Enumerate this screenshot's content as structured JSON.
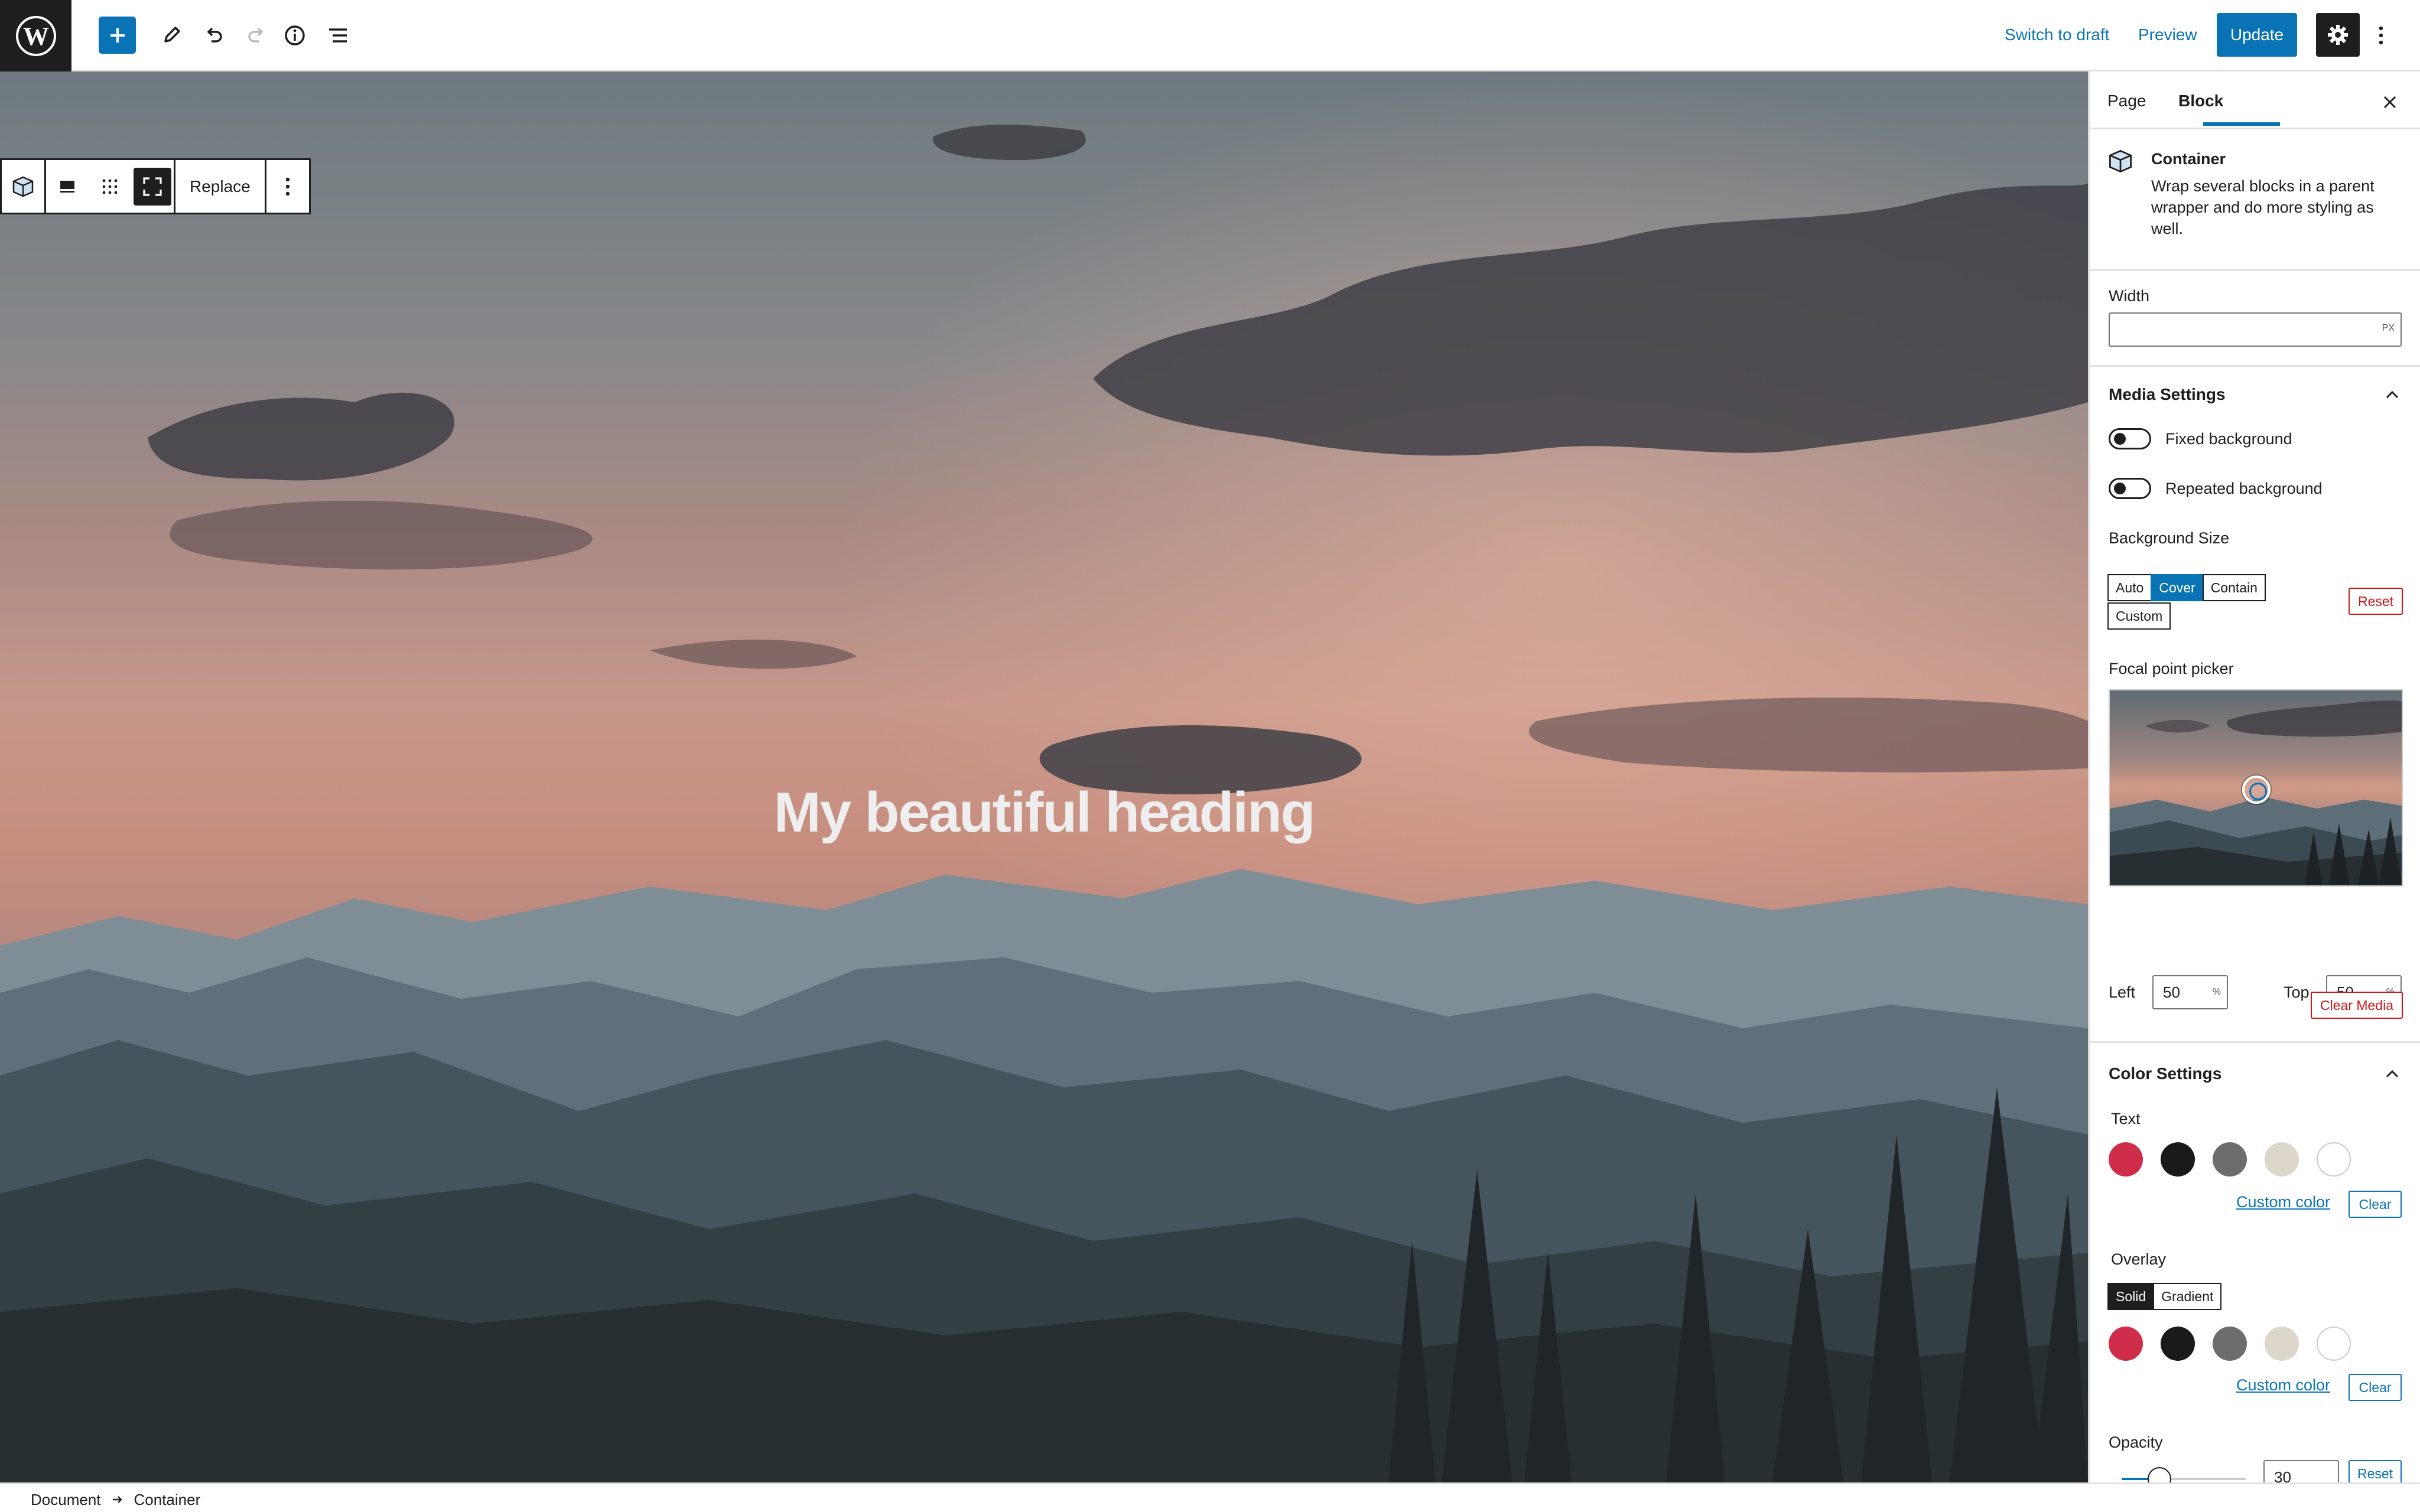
{
  "topbar": {
    "switch_to_draft": "Switch to draft",
    "preview": "Preview",
    "update": "Update"
  },
  "block_toolbar": {
    "replace_label": "Replace"
  },
  "canvas": {
    "heading": "My beautiful heading"
  },
  "sidebar": {
    "tabs": [
      {
        "label": "Page"
      },
      {
        "label": "Block",
        "active": true
      }
    ],
    "block_card": {
      "title": "Container",
      "description": "Wrap several blocks in a parent wrapper and do more styling as well."
    },
    "width": {
      "label": "Width",
      "value": "",
      "unit": "PX"
    },
    "media_settings": {
      "title": "Media Settings",
      "fixed_background": {
        "label": "Fixed background",
        "checked": false
      },
      "repeated_background": {
        "label": "Repeated background",
        "checked": false
      },
      "background_size": {
        "label": "Background Size",
        "options": [
          "Auto",
          "Cover",
          "Contain",
          "Custom"
        ],
        "selected": "Cover",
        "reset_label": "Reset"
      },
      "focal_point": {
        "label": "Focal point picker",
        "left_label": "Left",
        "left_value": "50",
        "top_label": "Top",
        "top_value": "50",
        "unit": "%"
      },
      "clear_media_label": "Clear Media"
    },
    "color_settings": {
      "title": "Color Settings",
      "text": {
        "label": "Text",
        "custom_color_label": "Custom color",
        "clear_label": "Clear"
      },
      "overlay": {
        "label": "Overlay",
        "modes": [
          "Solid",
          "Gradient"
        ],
        "selected_mode": "Solid",
        "custom_color_label": "Custom color",
        "clear_label": "Clear"
      },
      "swatches": [
        "#cf2e4a",
        "#1a1a1a",
        "#6d6d6d",
        "#dcd7ca",
        "#ffffff"
      ],
      "opacity": {
        "label": "Opacity",
        "value": "30",
        "reset_label": "Reset"
      }
    }
  },
  "footer": {
    "breadcrumb": [
      "Document",
      "Container"
    ]
  },
  "colors": {
    "accent": "#0a73b5",
    "danger": "#cc1818",
    "dark": "#1e1e1e"
  }
}
